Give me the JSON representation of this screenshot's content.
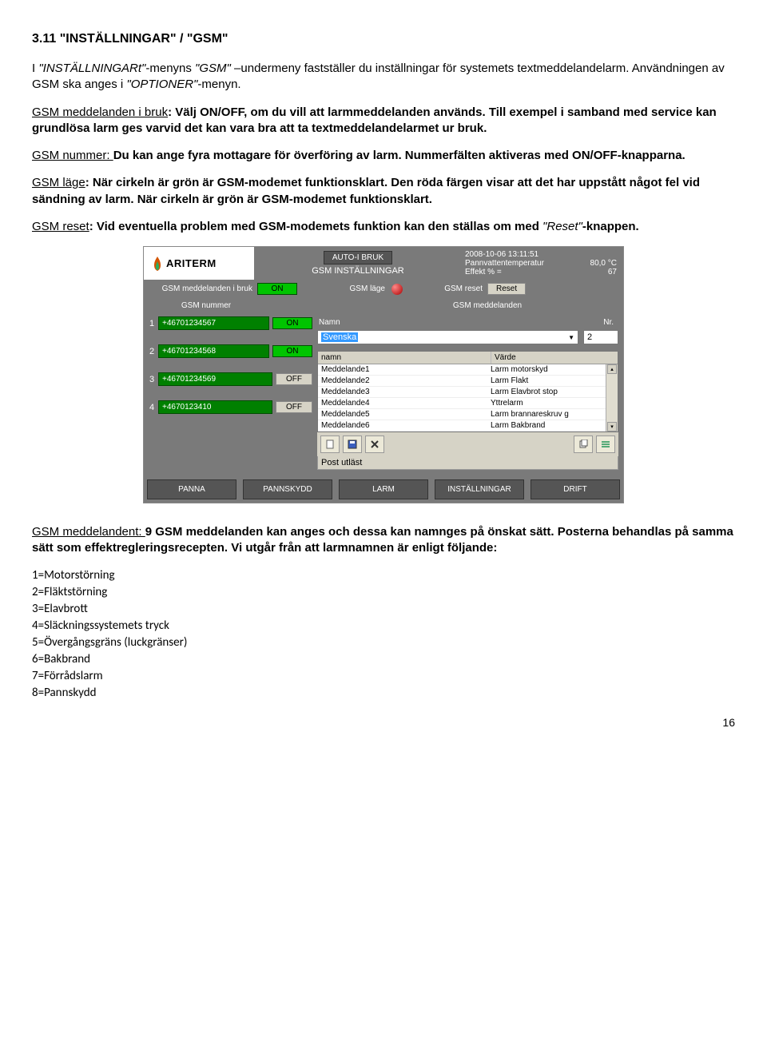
{
  "heading": "3.11 \"INSTÄLLNINGAR\" / \"GSM\"",
  "p1_a": "I ",
  "p1_b": "\"INSTÄLLNINGARt\"",
  "p1_c": "-menyns ",
  "p1_d": "\"GSM\"",
  "p1_e": " –undermeny fastställer du inställningar för systemets textmeddelandelarm. Användningen av GSM ska anges i ",
  "p1_f": "\"OPTIONER\"",
  "p1_g": "-menyn.",
  "p2_a": "GSM meddelanden i bruk",
  "p2_b": ": Välj ON/OFF, om du vill att larmmeddelanden används. Till exempel i samband med service kan grundlösa larm ges varvid det kan vara bra att ta textmeddelandelarmet ur bruk.",
  "p3_a": "GSM nummer: ",
  "p3_b": "Du kan ange fyra mottagare för överföring av larm. Nummerfälten aktiveras med ON/OFF-knapparna.",
  "p4_a": "GSM  läge",
  "p4_b": ": När cirkeln är grön är GSM-modemet funktionsklart. Den röda färgen visar att det har uppstått något fel vid sändning av larm. När cirkeln är grön är GSM-modemet funktionsklart.",
  "p5_a": "GSM reset",
  "p5_b": ": Vid eventuella problem med GSM-modemets funktion kan den ställas om med ",
  "p5_c": "\"Reset\"",
  "p5_d": "-knappen.",
  "p6_a": "GSM meddelandent: ",
  "p6_b": "9 GSM meddelanden kan anges och dessa kan namnges på önskat sätt. Posterna behandlas på samma sätt som effektregleringsrecepten. Vi utgår från att larmnamnen är enligt följande:",
  "larm": {
    "l1": "1=Motorstörning",
    "l2": "2=Fläktstörning",
    "l3": "3=Elavbrott",
    "l4": "4=Släckningssystemets tryck",
    "l5": "5=Övergångsgräns (luckgränser)",
    "l6": "6=Bakbrand",
    "l7": "7=Förrådslarm",
    "l8": "8=Pannskydd"
  },
  "pagenum": "16",
  "shot": {
    "brand": "ARITERM",
    "auto_btn": "AUTO-I BRUK",
    "title": "GSM INSTÄLLNINGAR",
    "status_time": "2008-10-06 13:11:51",
    "status_temp_k": "Pannvattentemperatur",
    "status_temp_v": "80,0 °C",
    "status_eff_k": "Effekt % =",
    "status_eff_v": "67",
    "row1": {
      "a": "GSM meddelanden i bruk",
      "a_btn": "ON",
      "b": "GSM läge",
      "c": "GSM reset",
      "c_btn": "Reset"
    },
    "row2": {
      "a": "GSM nummer",
      "b": "GSM meddelanden"
    },
    "numbers": [
      {
        "idx": "1",
        "val": "+46701234567",
        "state": "ON"
      },
      {
        "idx": "2",
        "val": "+46701234568",
        "state": "ON"
      },
      {
        "idx": "3",
        "val": "+46701234569",
        "state": "OFF"
      },
      {
        "idx": "4",
        "val": "+4670123410",
        "state": "OFF"
      }
    ],
    "name_lbl": "Namn",
    "nr_lbl": "Nr.",
    "sel_val": "Svenska",
    "sel_nr": "2",
    "table": {
      "h1": "namn",
      "h2": "Värde",
      "rows": [
        {
          "c1": "Meddelande1",
          "c2": "Larm motorskyd"
        },
        {
          "c1": "Meddelande2",
          "c2": "Larm Flakt"
        },
        {
          "c1": "Meddelande3",
          "c2": "Larm Elavbrot stop"
        },
        {
          "c1": "Meddelande4",
          "c2": "Yttrelarm"
        },
        {
          "c1": "Meddelande5",
          "c2": "Larm brannareskruv g"
        },
        {
          "c1": "Meddelande6",
          "c2": "Larm Bakbrand"
        }
      ]
    },
    "post": "Post utläst",
    "nav": [
      "PANNA",
      "PANNSKYDD",
      "LARM",
      "INSTÄLLNINGAR",
      "DRIFT"
    ]
  }
}
